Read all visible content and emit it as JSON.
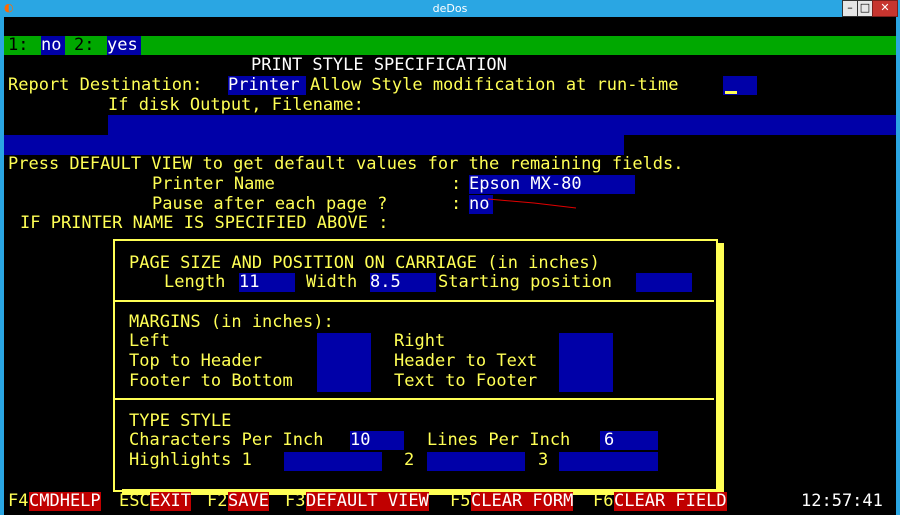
{
  "window": {
    "title": "deDos",
    "icon": "app-icon",
    "buttons": {
      "minimize": "–",
      "maximize": "□",
      "close": "✕"
    }
  },
  "menu_line": {
    "opt1_key": "1:",
    "opt1_label": "no",
    "opt2_key": "2:",
    "opt2_label": "yes"
  },
  "form": {
    "title": "PRINT STYLE SPECIFICATION",
    "report_destination_label": "Report Destination:",
    "report_destination_value": "Printer",
    "allow_style_label": "Allow Style modification at run-time",
    "allow_style_value": "",
    "disk_output_label": "If disk Output, Filename:",
    "filename_value": "",
    "default_view_hint": "Press DEFAULT VIEW to get default values for the remaining fields.",
    "printer_name_label": "Printer Name",
    "printer_name_value": "Epson MX-80",
    "pause_label": "Pause after each page ?",
    "pause_value": "no",
    "colon": ":",
    "if_printer_label": "IF PRINTER NAME IS SPECIFIED ABOVE :"
  },
  "page_size": {
    "heading": "PAGE SIZE AND POSITION ON CARRIAGE (in inches)",
    "length_label": "Length",
    "length_value": "11",
    "width_label": "Width",
    "width_value": "8.5",
    "start_label": "Starting position",
    "start_value": ""
  },
  "margins": {
    "heading": "MARGINS (in inches):",
    "left_label": "Left",
    "right_label": "Right",
    "top_header_label": "Top to Header",
    "header_text_label": "Header to Text",
    "footer_bottom_label": "Footer to Bottom",
    "text_footer_label": "Text to Footer",
    "left_value": "",
    "right_value": "",
    "top_header_value": "",
    "header_text_value": "",
    "footer_bottom_value": "",
    "text_footer_value": ""
  },
  "type_style": {
    "heading": "TYPE STYLE",
    "cpi_label": "Characters Per Inch",
    "cpi_value": "10",
    "lpi_label": "Lines Per Inch",
    "lpi_value": "6",
    "highlights_label": "Highlights 1",
    "h1_value": "",
    "h2_label": "2",
    "h2_value": "",
    "h3_label": "3",
    "h3_value": ""
  },
  "function_keys": [
    {
      "key": "F4",
      "label": "CMDHELP"
    },
    {
      "key": "ESC",
      "label": "EXIT"
    },
    {
      "key": "F2",
      "label": "SAVE"
    },
    {
      "key": "F3",
      "label": "DEFAULT VIEW"
    },
    {
      "key": "F5",
      "label": "CLEAR FORM"
    },
    {
      "key": "F6",
      "label": "CLEAR FIELD"
    }
  ],
  "clock": "12:57:41",
  "colors": {
    "text_yellow": "#ffff55",
    "field_blue": "#0000a8",
    "menu_green": "#00a800",
    "fkey_red": "#c00000",
    "title_blue": "#2aa6e3",
    "annotation_red": "#e00000"
  }
}
